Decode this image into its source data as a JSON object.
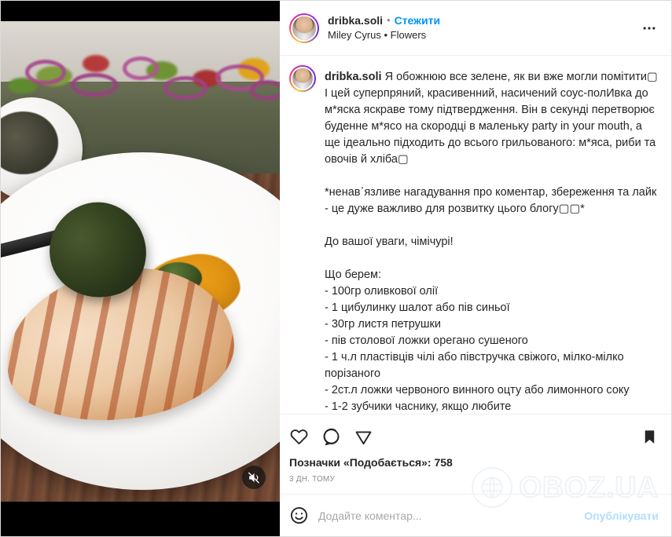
{
  "header": {
    "username": "dribka.soli",
    "separator": "•",
    "follow_label": "Стежити",
    "audio_track": "Miley Cyrus • Flowers",
    "more_icon": "more-horizontal-icon",
    "avatar_icon": "avatar"
  },
  "caption": {
    "username": "dribka.soli",
    "text": "Я обожнюю все зелене, як ви вже могли помітити▢ І цей суперпряний, красивенний, насичений соус-полИвка до м*яска яскраве тому підтвердження. Він в секунді перетворює буденне м*ясо на скородці в маленьку party in your mouth, а ще ідеально підходить до всього грильованого: м*яса, риби та овочів й хліба▢\n\n*ненав᾽язливе нагадування про коментар, збереження та лайк - це дуже важливо для розвитку цього блогу▢▢*\n\nДо вашої уваги, чімічурі!\n\nЩо берем:\n- 100гр оливкової олії\n- 1 цибулинку шалот або пів синьої\n- 30гр листя петрушки\n- пів столової ложки орегано сушеного\n- 1 ч.л пластівців чілі або півстручка свіжого, мілко-мілко порізаного\n- 2ст.л ложки червоного винного оцту або лимонного соку\n- 1-2 зубчики часнику, якщо любите\n- сіль і перець - за смаком\n\nОтже, що робим:"
  },
  "actions": {
    "like_icon": "heart-icon",
    "comment_icon": "comment-bubble-icon",
    "share_icon": "share-paperplane-icon",
    "save_icon": "bookmark-icon",
    "likes_label": "Позначки «Подобається»: 758",
    "likes_count": "758",
    "timestamp": "3 дн. тому"
  },
  "composer": {
    "emoji_icon": "emoji-smiley-icon",
    "placeholder": "Додайте коментар...",
    "value": "",
    "post_label": "Опублікувати"
  },
  "media": {
    "type": "video",
    "mute_icon": "speaker-muted-icon",
    "muted": "true",
    "description": "Grilled chicken fillet on white plate with chimichurri sauce spoon"
  },
  "watermark": {
    "text": "OBOZ.UA",
    "globe_icon": "globe-icon"
  },
  "colors": {
    "accent_blue": "#0095f6",
    "post_btn_blue": "#b3dcfd",
    "text_primary": "#262626",
    "text_secondary": "#8e8e8e",
    "border": "#efefef"
  }
}
